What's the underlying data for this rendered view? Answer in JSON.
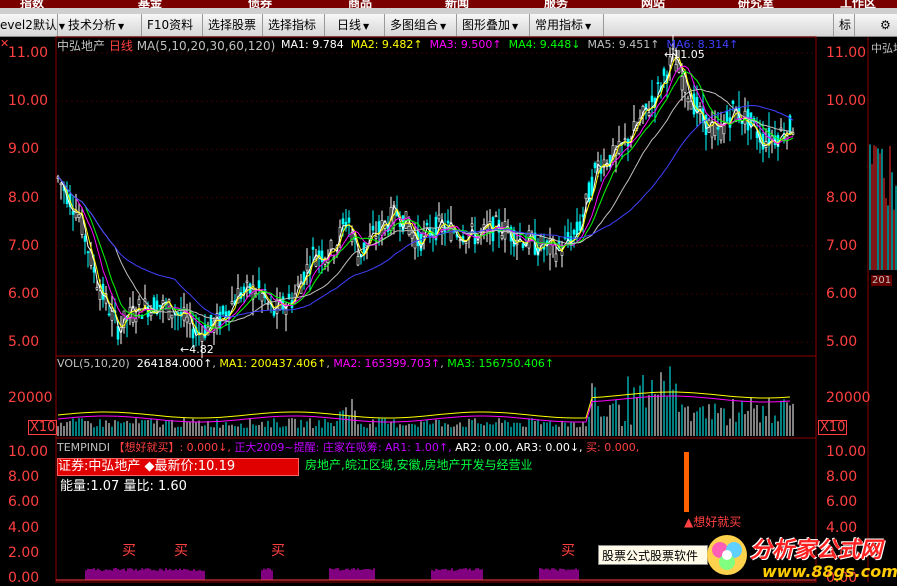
{
  "top_nav": [
    "指数",
    "基金",
    "债券",
    "商品",
    "新闻",
    "服务",
    "网站",
    "研究室",
    "工作区"
  ],
  "toolbar": {
    "level2": "evel2默认",
    "items": [
      "技术分析",
      "F10资料",
      "选择股票",
      "选择指标",
      "日线",
      "多图组合",
      "图形叠加",
      "常用指标"
    ],
    "right": "标"
  },
  "main": {
    "title": "中弘地产",
    "period": "日线",
    "ma_spec": "MA(5,10,20,30,60,120)",
    "ma_values": [
      {
        "label": "MA1: 9.784",
        "color": "#ffffff"
      },
      {
        "label": "MA2: 9.482↑",
        "color": "#ffff00"
      },
      {
        "label": "MA3: 9.500↑",
        "color": "#ff00ff"
      },
      {
        "label": "MA4: 9.448↓",
        "color": "#00ff00"
      },
      {
        "label": "MA5: 9.451↑",
        "color": "#c0c0c0"
      },
      {
        "label": "MA6: 8.314↑",
        "color": "#4040ff"
      }
    ],
    "y_ticks": [
      "11.00",
      "10.00",
      "9.00",
      "8.00",
      "7.00",
      "6.00",
      "5.00"
    ],
    "low_label": "←4.82",
    "high_label": "←11.05"
  },
  "volume": {
    "spec": "VOL(5,10,20)",
    "values": [
      {
        "label": "264184.000↑",
        "color": "#ffffff"
      },
      {
        "label": "MA1: 200437.406↑",
        "color": "#ffff00"
      },
      {
        "label": "MA2: 165399.703↑",
        "color": "#ff00ff"
      },
      {
        "label": "MA3: 156750.406↑",
        "color": "#00ff00"
      }
    ],
    "tick": "20000",
    "scale": "X10"
  },
  "indicator": {
    "name": "TEMPINDI",
    "items": [
      {
        "label": "【想好就买】: 0.000↓,",
        "color": "#ff4040"
      },
      {
        "label": "正大2009~提醒: 庄家在吸筹: AR1: 1.00↑,",
        "color": "#c000ff"
      },
      {
        "label": "AR2: 0.00,",
        "color": "#ffffff"
      },
      {
        "label": "AR3: 0.00↓,",
        "color": "#ffffff"
      },
      {
        "label": "买: 0.000,",
        "color": "#ff4040"
      }
    ],
    "y_ticks": [
      "10.00",
      "8.00",
      "6.00",
      "4.00",
      "2.00",
      "0.00"
    ],
    "stock_box": "证券:中弘地产   ◆最新价:10.19",
    "info": "房地产,皖江区域,安徽,房地产开发与经营业",
    "energy": "能量:1.07  量比: 1.60",
    "signal": "▲想好就买",
    "buy_label": "买"
  },
  "right_panel": {
    "y_ticks": [
      "11.00",
      "10.00",
      "9.00",
      "8.00",
      "7.00",
      "6.00",
      "5.00"
    ],
    "vol_tick": "20000",
    "scale": "X10",
    "ind_ticks": [
      "10.00",
      "8.00",
      "6.00",
      "4.00",
      "2.00",
      "0.00"
    ],
    "mini_title": "中弘地",
    "mini_date": "201"
  },
  "ad": {
    "text": "股票公式股票软件",
    "site_name": "分析家公式网",
    "site_url": "www.88gs.com"
  }
}
